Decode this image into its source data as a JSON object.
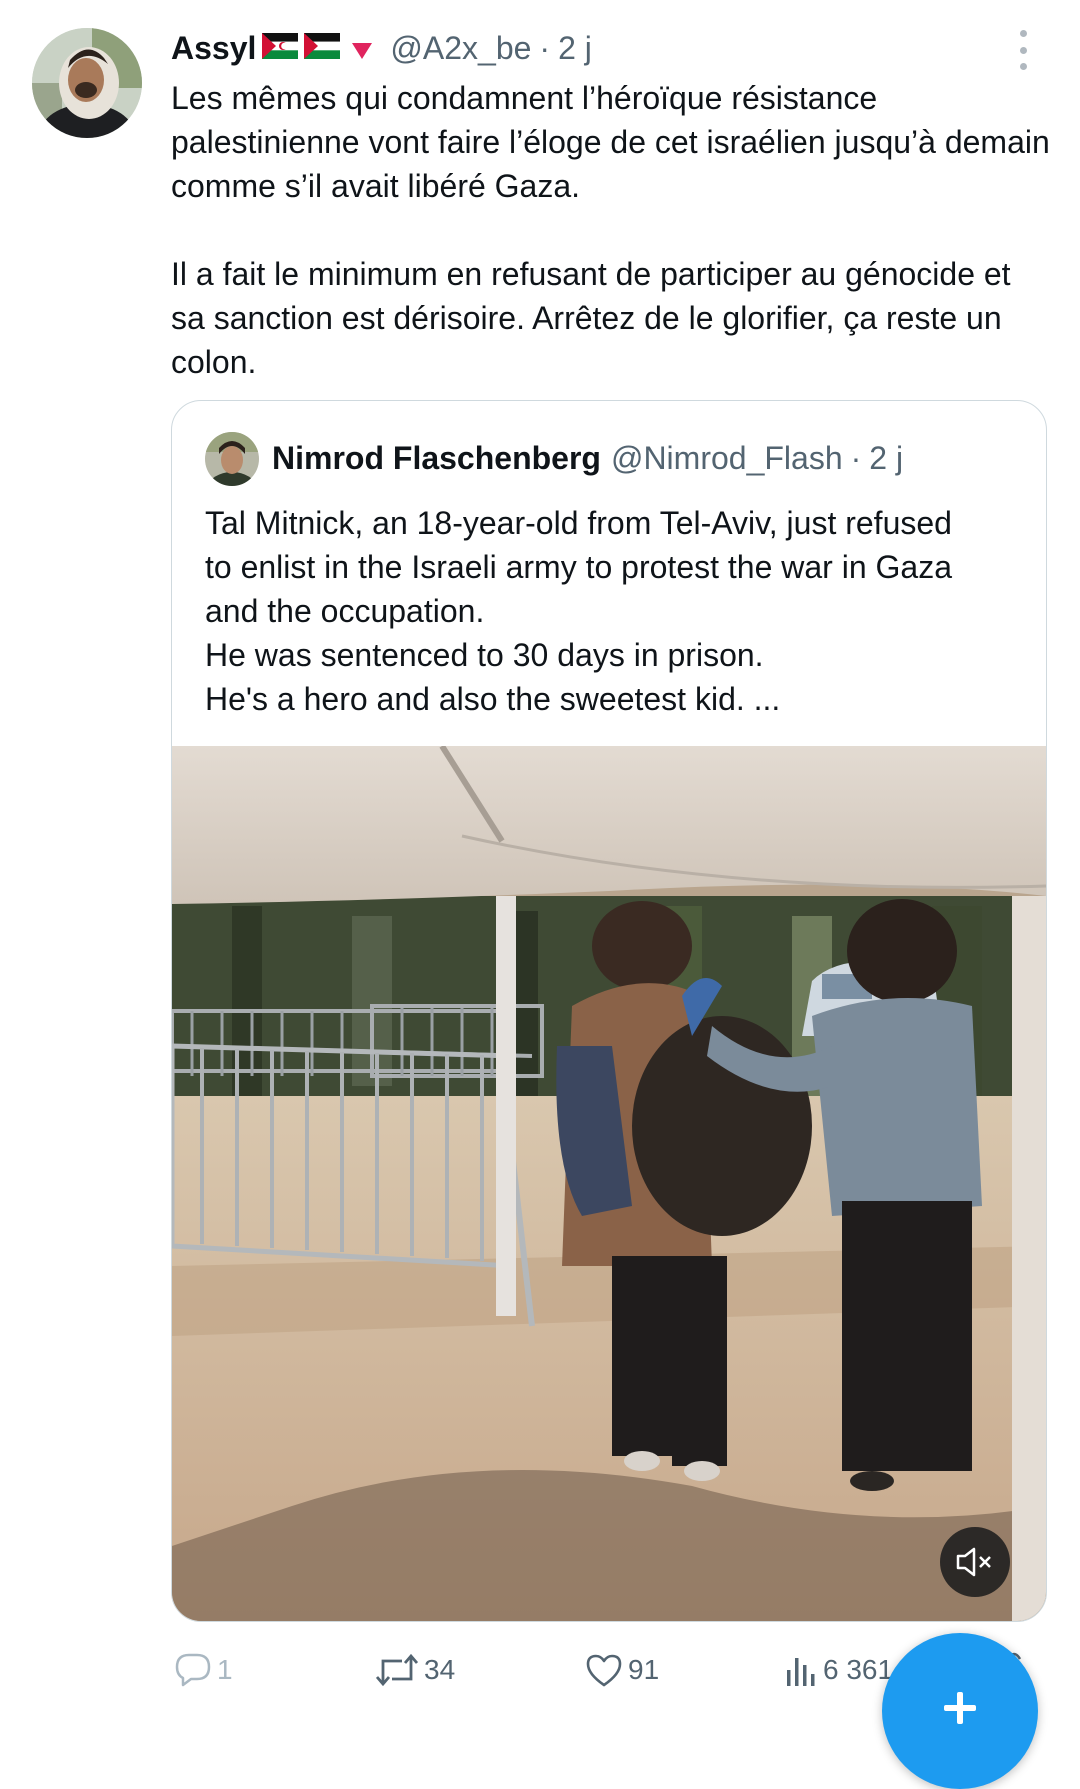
{
  "tweet": {
    "author_name": "Assyl",
    "author_handle": "@A2x_be",
    "separator": "·",
    "time": "2 j",
    "text_paragraphs": [
      "Les mêmes qui condamnent l’héroïque résistance palestinienne vont faire l’éloge de cet israélien jusqu’à demain comme s’il avait libéré Gaza.",
      "Il a fait le minimum en refusant de participer au génocide et sa sanction est dérisoire. Arrêtez de le glorifier, ça reste un colon."
    ]
  },
  "quoted": {
    "author_name": "Nimrod Flaschenberg",
    "author_handle": "@Nimrod_Flash",
    "separator": "·",
    "time": "2 j",
    "lines": [
      "Tal Mitnick, an 18-year-old from Tel-Aviv, just refused",
      "to enlist in the Israeli army to protest the war in Gaza",
      "and the occupation.",
      "He was sentenced to 30 days in prison.",
      "He's a hero and also the sweetest kid. ..."
    ]
  },
  "actions": {
    "reply_count": "1",
    "retweet_count": "34",
    "like_count": "91",
    "views_count": "6 361"
  },
  "icons": {
    "avatar": "avatar-photo",
    "flags": [
      "western-sahara-flag-icon",
      "palestine-flag-icon"
    ],
    "triangle": "red-triangle-icon",
    "more": "more-vertical-icon",
    "mute": "muted-speaker-icon",
    "reply": "reply-icon",
    "retweet": "retweet-icon",
    "like": "heart-icon",
    "views": "views-icon",
    "compose": "plus-icon"
  },
  "colors": {
    "text": "#0f1419",
    "secondary": "#536471",
    "accent": "#1d9bf0",
    "border": "#cfd9de",
    "triangle": "#e0245e"
  }
}
